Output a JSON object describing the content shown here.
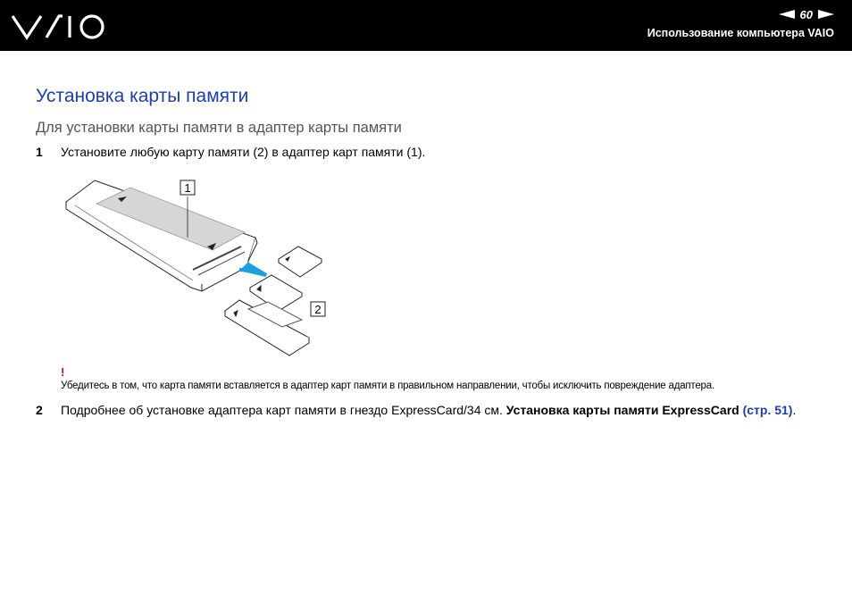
{
  "header": {
    "brand": "VAIO",
    "page_number": "60",
    "section_title": "Использование компьютера VAIO"
  },
  "title": "Установка карты памяти",
  "subtitle": "Для установки карты памяти в адаптер карты памяти",
  "steps": [
    {
      "number": "1",
      "text": "Установите любую карту памяти (2) в адаптер карт памяти (1)."
    },
    {
      "number": "2",
      "text_before": "Подробнее об установке адаптера карт памяти в гнездо ExpressCard/34 см. ",
      "bold_text": "Установка карты памяти ExpressCard",
      "link_text": "(стр. 51)",
      "text_after": "."
    }
  ],
  "figure": {
    "callout_1": "1",
    "callout_2": "2"
  },
  "warning": {
    "mark": "!",
    "text": "Убедитесь в том, что карта памяти вставляется в адаптер карт памяти в правильном направлении, чтобы исключить повреждение адаптера."
  },
  "colors": {
    "header_bg": "#000000",
    "title": "#1f3ea8",
    "arrow": "#1aa0dc",
    "warning": "#dd0000"
  }
}
